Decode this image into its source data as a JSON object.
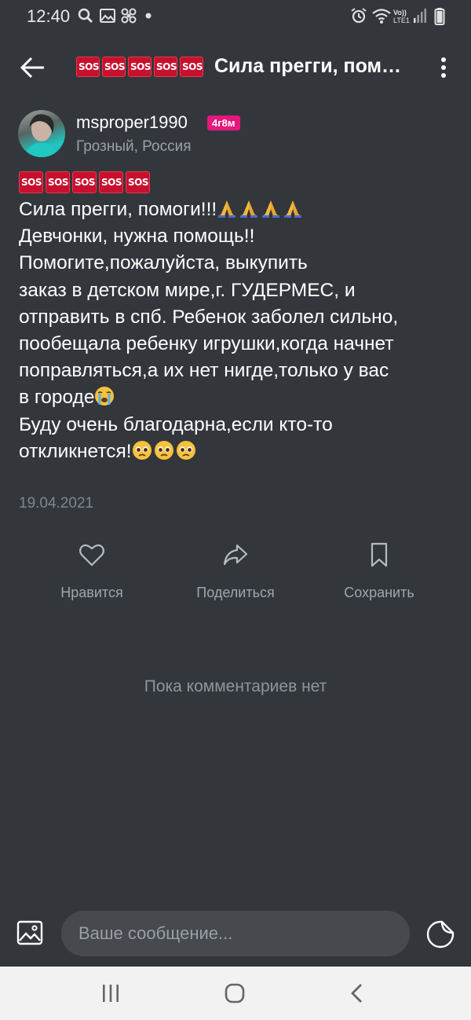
{
  "status_bar": {
    "time": "12:40",
    "left_icons": [
      "search-icon",
      "image-icon",
      "pinwheel-icon",
      "dot-icon"
    ],
    "right_icons": [
      "alarm-icon",
      "wifi-icon",
      "volte-lte-icon",
      "signal-icon",
      "battery-icon"
    ],
    "volte_label": "Vo)) LTE1"
  },
  "header": {
    "sos_labels": [
      "SOS",
      "SOS",
      "SOS",
      "SOS",
      "SOS"
    ],
    "title": "Сила прегги, пом…"
  },
  "post": {
    "author": "msproper1990",
    "badge": "4г8м",
    "location": "Грозный, Россия",
    "sos_labels": [
      "SOS",
      "SOS",
      "SOS",
      "SOS",
      "SOS"
    ],
    "lines": [
      "Сила прегги, помоги!!!",
      "Девчонки, нужна помощь!!",
      "Помогите,пожалуйста, выкупить",
      "заказ в детском мире,г. ГУДЕРМЕС, и",
      "отправить в спб. Ребенок заболел сильно,",
      "пообещала ребенку игрушки,когда начнет",
      "поправляться,а их нет нигде,только у вас",
      "в городе",
      "Буду очень благодарна,если кто-то",
      "откликнется!"
    ],
    "date": "19.04.2021"
  },
  "actions": {
    "like": "Нравится",
    "share": "Поделиться",
    "save": "Сохранить"
  },
  "comments": {
    "empty_text": "Пока комментариев нет"
  },
  "composer": {
    "placeholder": "Ваше сообщение..."
  },
  "colors": {
    "background": "#33373c",
    "sos_red": "#c8102e",
    "badge_pink": "#e8177c",
    "input_bg": "#46494e",
    "nav_bg": "#f2f2f2"
  }
}
